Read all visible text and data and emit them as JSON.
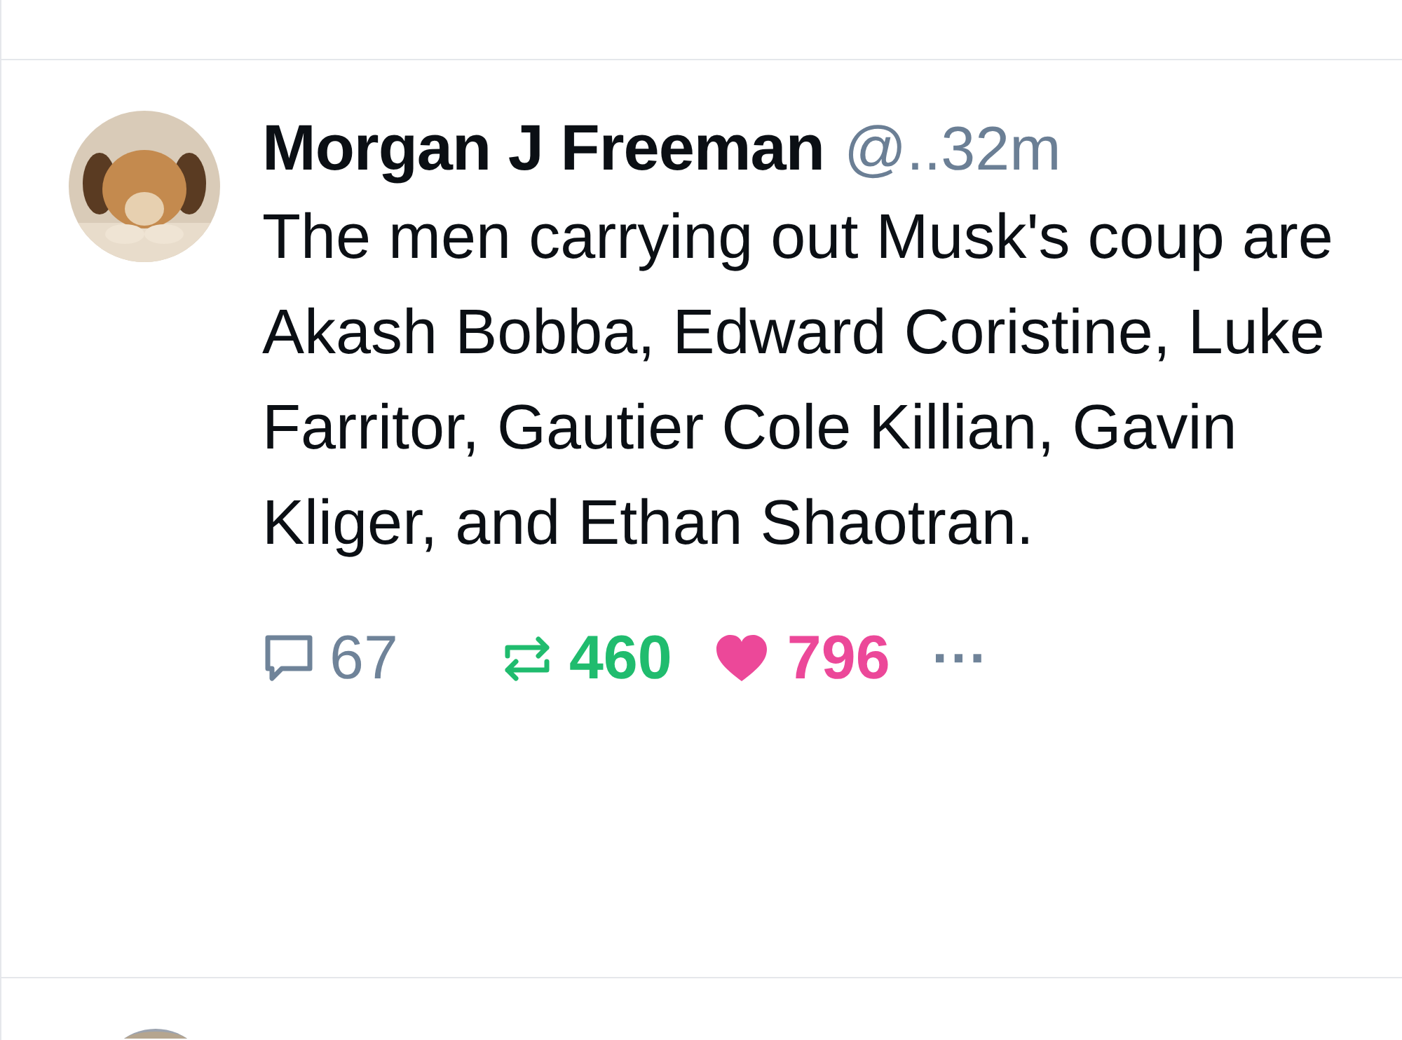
{
  "post": {
    "author": "Morgan J Freeman",
    "handle": "@..",
    "time": "32m",
    "text": "The men carrying out Musk's coup are Akash Bobba, Edward Coristine, Luke Farritor, Gautier Cole Killian, Gavin Kliger, and Ethan Shaotran.",
    "replies": "67",
    "reposts": "460",
    "reposted": true,
    "likes": "796",
    "liked": true,
    "more": "···"
  }
}
